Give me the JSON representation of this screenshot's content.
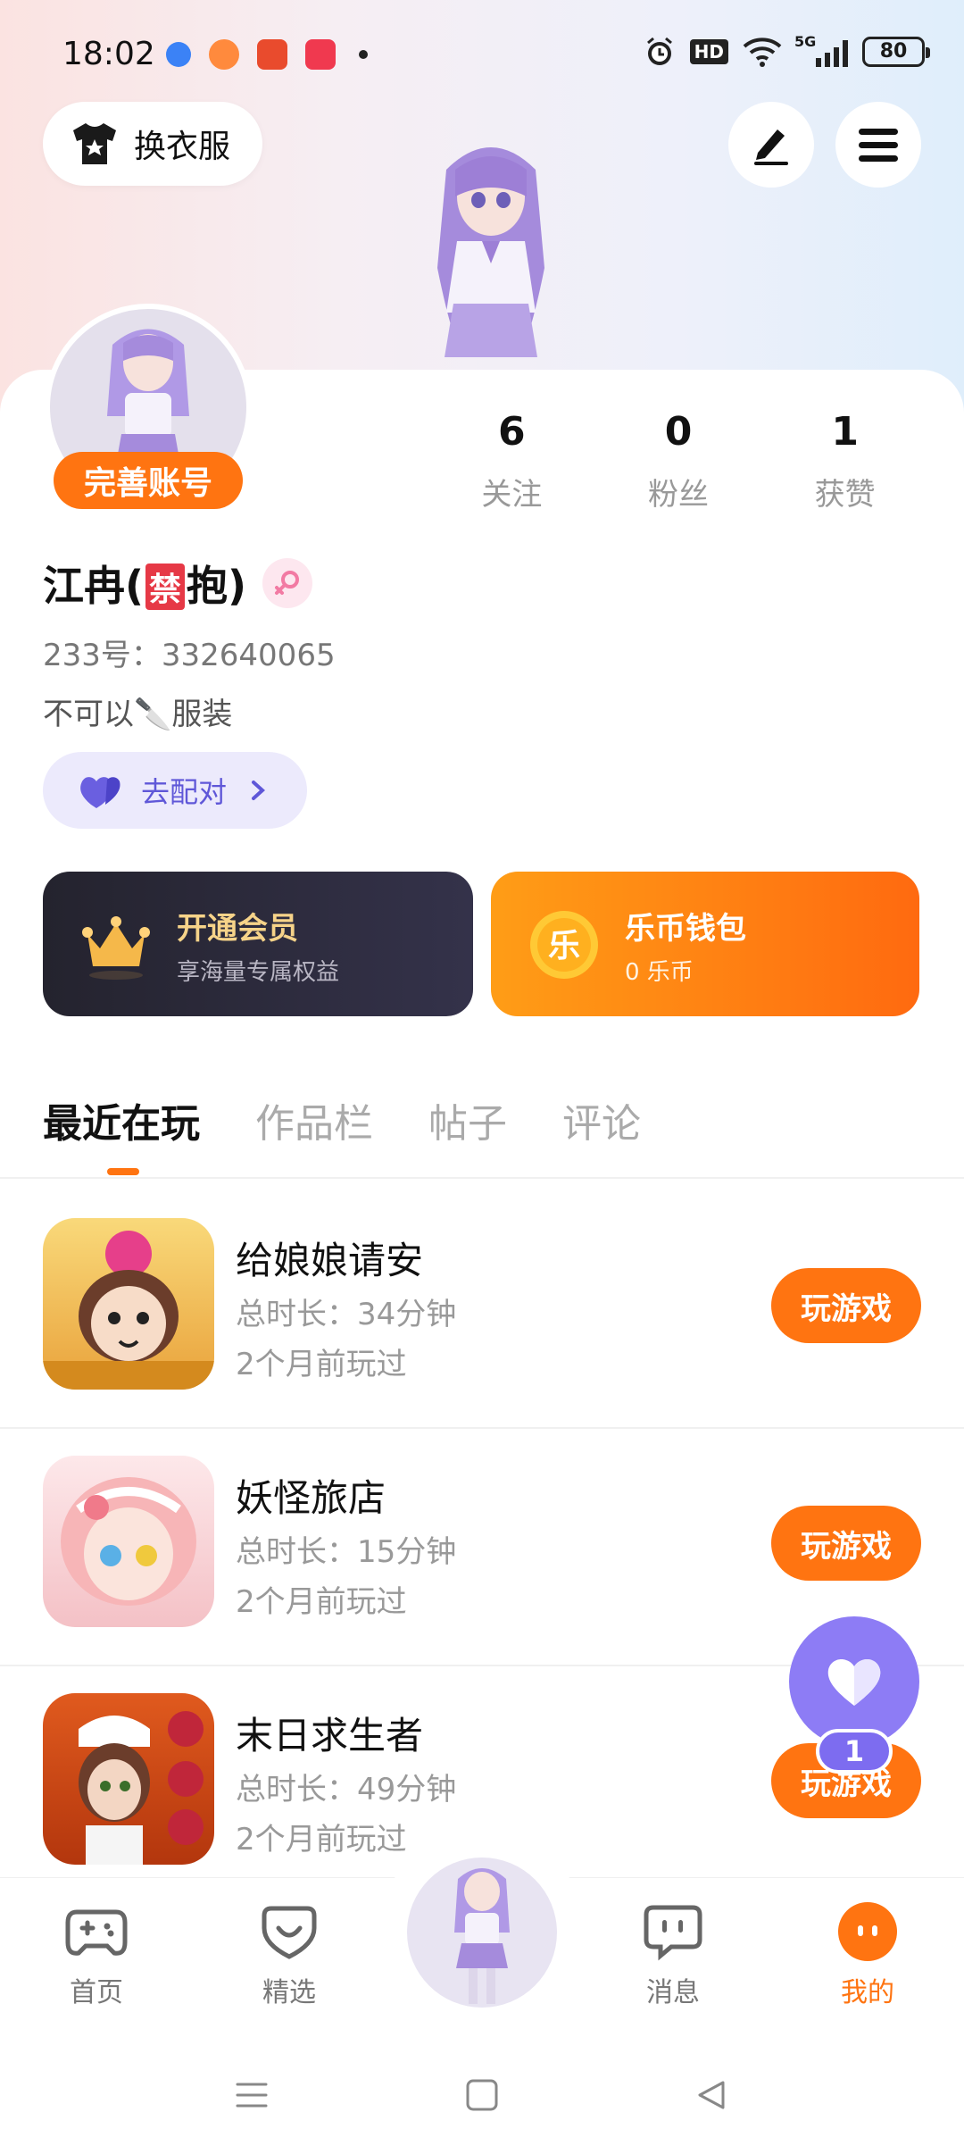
{
  "status_bar": {
    "time": "18:02",
    "battery": "80",
    "network": "5G",
    "hd_label": "HD"
  },
  "top_bar": {
    "dress_up_label": "换衣服"
  },
  "profile": {
    "complete_account_label": "完善账号",
    "name_prefix": "江冉(",
    "name_ban": "禁",
    "name_suffix": "抱)",
    "uid": "233号：332640065",
    "bio": "不可以🔪服装",
    "match_label": "去配对"
  },
  "stats": [
    {
      "value": "6",
      "label": "关注"
    },
    {
      "value": "0",
      "label": "粉丝"
    },
    {
      "value": "1",
      "label": "获赞"
    }
  ],
  "cards": {
    "vip_title": "开通会员",
    "vip_subtitle": "享海量专属权益",
    "wallet_title": "乐币钱包",
    "wallet_subtitle": "0 乐币",
    "coin_glyph": "乐"
  },
  "tabs": [
    "最近在玩",
    "作品栏",
    "帖子",
    "评论"
  ],
  "games": [
    {
      "title": "给娘娘请安",
      "duration": "总时长：34分钟",
      "last_played": "2个月前玩过",
      "button": "玩游戏"
    },
    {
      "title": "妖怪旅店",
      "duration": "总时长：15分钟",
      "last_played": "2个月前玩过",
      "button": "玩游戏"
    },
    {
      "title": "末日求生者",
      "duration": "总时长：49分钟",
      "last_played": "2个月前玩过",
      "button": "玩游戏"
    }
  ],
  "floating": {
    "badge": "1"
  },
  "bottom_nav": [
    {
      "label": "首页",
      "icon": "gamepad-icon"
    },
    {
      "label": "精选",
      "icon": "heart-pocket-icon"
    },
    {
      "label": "消息",
      "icon": "chat-icon"
    },
    {
      "label": "我的",
      "icon": "profile-face-icon"
    }
  ],
  "colors": {
    "accent": "#ff7411",
    "purple": "#8d7cf5",
    "vip_bg": "#24232e"
  }
}
